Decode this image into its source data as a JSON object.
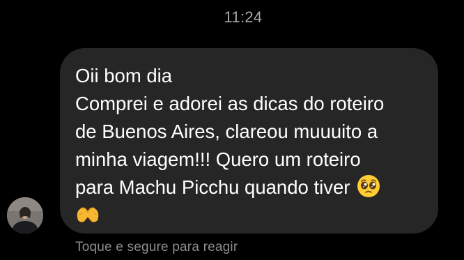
{
  "timestamp": "11:24",
  "message": {
    "lines": [
      "Oii bom dia",
      "Comprei e adorei as dicas do roteiro",
      "de Buenos Aires, clareou muuuito a",
      "minha viagem!!! Quero um roteiro",
      "para Machu Picchu quando tiver"
    ],
    "emojis": [
      "pleading-face-icon",
      "heart-hands-icon"
    ]
  },
  "reaction_hint": "Toque e segure para reagir",
  "colors": {
    "background": "#000000",
    "bubble": "#262626",
    "text": "#ffffff",
    "timestamp": "#a8a8a8",
    "hint": "#8e8e8e"
  }
}
